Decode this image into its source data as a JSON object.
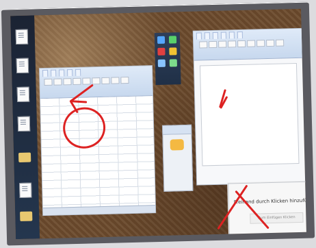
{
  "photo": {
    "desktop": {
      "left_window": {
        "tabs": [
          "",
          "",
          "",
          "",
          ""
        ],
        "cells": [
          "",
          "",
          "",
          "",
          "",
          "",
          "",
          "",
          "",
          "",
          ""
        ],
        "sheet_tabs": [
          "",
          "",
          ""
        ]
      },
      "right_window": {
        "tabs": [
          "",
          "",
          "",
          "",
          "",
          ""
        ]
      },
      "clip_dialog": {
        "title": "Freihand durch Klicken hinzufügen",
        "subtitle": "Zum Einfügen Klicken"
      }
    }
  }
}
